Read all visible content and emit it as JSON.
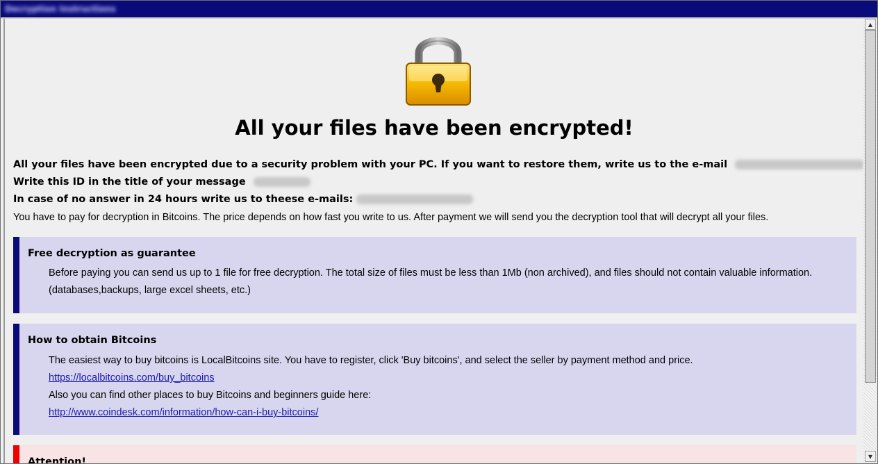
{
  "window": {
    "title": "Decryption Instructions"
  },
  "lock_icon": "padlock-icon",
  "heading": "All your files have been encrypted!",
  "intro": {
    "line1": "All your files have been encrypted due to a security problem with your PC. If you want to restore them, write us to the e-mail",
    "line2": "Write this ID in the title of your message",
    "line3": "In case of no answer in 24 hours write us to theese e-mails:",
    "line4": "You have to pay for decryption in Bitcoins. The price depends on how fast you write to us. After payment we will send you the decryption tool that will decrypt all your files."
  },
  "free_decryption": {
    "title": "Free decryption as guarantee",
    "line1": "Before paying you can send us up to 1 file for free decryption. The total size of files must be less than 1Mb (non archived), and files should not contain valuable information.",
    "line2": "(databases,backups, large excel sheets, etc.)"
  },
  "obtain_bitcoins": {
    "title": "How to obtain Bitcoins",
    "line1": "The easiest way to buy bitcoins is LocalBitcoins site. You have to register, click 'Buy bitcoins', and select the seller by payment method and price.",
    "link1": "https://localbitcoins.com/buy_bitcoins",
    "line2": "Also you can find other places to buy Bitcoins and beginners guide here:",
    "link2": "http://www.coindesk.com/information/how-can-i-buy-bitcoins/"
  },
  "attention": {
    "title": "Attention!"
  },
  "colors": {
    "title_bar": "#0a0a7a",
    "info_box": "#d8d6ee",
    "info_border": "#0a0a7a",
    "attention_box": "#f8e4e4",
    "attention_border": "#ee0000",
    "link": "#1a1ab0"
  }
}
